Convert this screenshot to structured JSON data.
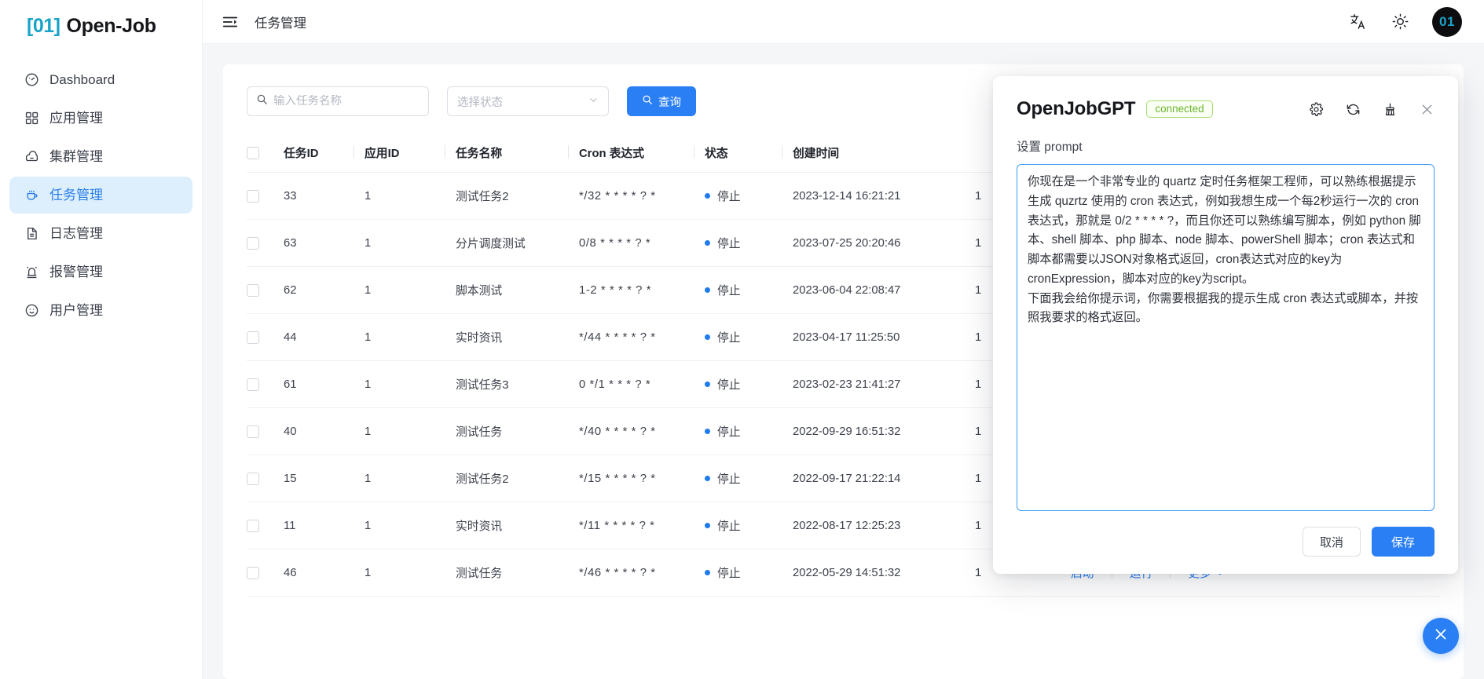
{
  "brand": {
    "mark": "[01]",
    "name": "Open-Job"
  },
  "sidebar": {
    "items": [
      {
        "label": "Dashboard",
        "icon": "dashboard-icon"
      },
      {
        "label": "应用管理",
        "icon": "apps-icon"
      },
      {
        "label": "集群管理",
        "icon": "cluster-icon"
      },
      {
        "label": "任务管理",
        "icon": "job-icon"
      },
      {
        "label": "日志管理",
        "icon": "log-icon"
      },
      {
        "label": "报警管理",
        "icon": "alarm-icon"
      },
      {
        "label": "用户管理",
        "icon": "user-icon"
      }
    ],
    "active_index": 3
  },
  "topbar": {
    "collapse_icon": "collapse-menu-icon",
    "breadcrumb": "任务管理",
    "translate_icon": "translate-icon",
    "theme_icon": "sun-icon",
    "avatar": "01"
  },
  "toolbar": {
    "search_placeholder": "输入任务名称",
    "search_value": "",
    "search_icon": "search-icon",
    "status_placeholder": "选择状态",
    "status_value": "",
    "query_label": "查询"
  },
  "table": {
    "columns": [
      "任务ID",
      "应用ID",
      "任务名称",
      "Cron 表达式",
      "状态",
      "创建时间"
    ],
    "actions": {
      "start": "启动",
      "run": "运行",
      "more": "更多"
    },
    "rows": [
      {
        "job_id": "33",
        "app_id": "1",
        "name": "测试任务2",
        "cron": "*/32 * * * * ? *",
        "status": "停止",
        "created": "2023-12-14 16:21:21",
        "version": "1"
      },
      {
        "job_id": "63",
        "app_id": "1",
        "name": "分片调度测试",
        "cron": "0/8 * * * * ? *",
        "status": "停止",
        "created": "2023-07-25 20:20:46",
        "version": "1"
      },
      {
        "job_id": "62",
        "app_id": "1",
        "name": "脚本测试",
        "cron": "1-2 * * * * ? *",
        "status": "停止",
        "created": "2023-06-04 22:08:47",
        "version": "1"
      },
      {
        "job_id": "44",
        "app_id": "1",
        "name": "实时资讯",
        "cron": "*/44 * * * * ? *",
        "status": "停止",
        "created": "2023-04-17 11:25:50",
        "version": "1"
      },
      {
        "job_id": "61",
        "app_id": "1",
        "name": "测试任务3",
        "cron": "0 */1 * * * ? *",
        "status": "停止",
        "created": "2023-02-23 21:41:27",
        "version": "1"
      },
      {
        "job_id": "40",
        "app_id": "1",
        "name": "测试任务",
        "cron": "*/40 * * * * ? *",
        "status": "停止",
        "created": "2022-09-29 16:51:32",
        "version": "1"
      },
      {
        "job_id": "15",
        "app_id": "1",
        "name": "测试任务2",
        "cron": "*/15 * * * * ? *",
        "status": "停止",
        "created": "2022-09-17 21:22:14",
        "version": "1"
      },
      {
        "job_id": "11",
        "app_id": "1",
        "name": "实时资讯",
        "cron": "*/11 * * * * ? *",
        "status": "停止",
        "created": "2022-08-17 12:25:23",
        "version": "1"
      },
      {
        "job_id": "46",
        "app_id": "1",
        "name": "测试任务",
        "cron": "*/46 * * * * ? *",
        "status": "停止",
        "created": "2022-05-29 14:51:32",
        "version": "1"
      }
    ]
  },
  "dialog": {
    "title": "OpenJobGPT",
    "badge": "connected",
    "icons": [
      "gear-icon",
      "refresh-icon",
      "broom-icon",
      "close-icon"
    ],
    "subtitle": "设置 prompt",
    "prompt": "你现在是一个非常专业的 quartz 定时任务框架工程师，可以熟练根据提示生成 quzrtz 使用的 cron 表达式，例如我想生成一个每2秒运行一次的 cron 表达式，那就是 0/2 * * * * ?，而且你还可以熟练编写脚本，例如 python 脚本、shell 脚本、php 脚本、node 脚本、powerShell 脚本；cron 表达式和脚本都需要以JSON对象格式返回，cron表达式对应的key为cronExpression，脚本对应的key为script。\n下面我会给你提示词，你需要根据我的提示生成 cron 表达式或脚本，并按照我要求的格式返回。",
    "cancel_label": "取消",
    "save_label": "保存"
  },
  "fab": {
    "icon": "close-icon"
  },
  "colors": {
    "accent": "#2b7ff5",
    "brand_mark": "#1aa3c8",
    "active_nav_bg": "#ddeefd",
    "active_nav_text": "#2b7fe8",
    "badge_green": "#6cb52e",
    "status_dot": "#1f7bf0"
  }
}
